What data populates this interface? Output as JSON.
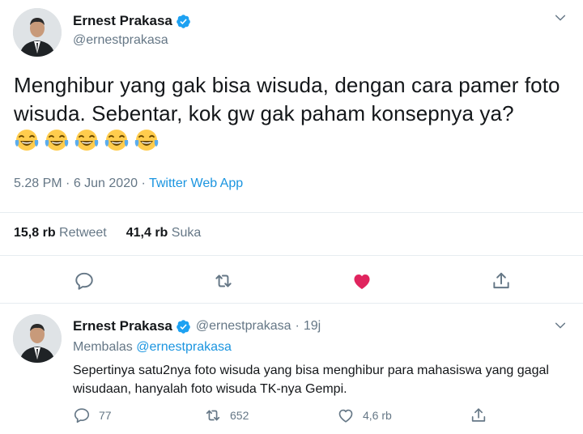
{
  "main_tweet": {
    "author_name": "Ernest Prakasa",
    "handle": "@ernestprakasa",
    "text": "Menghibur yang gak bisa wisuda, dengan cara pamer foto wisuda. Sebentar, kok gw gak paham konsepnya ya? ",
    "emojis": [
      "face-with-tears-of-joy",
      "face-with-tears-of-joy",
      "face-with-tears-of-joy",
      "face-with-tears-of-joy",
      "face-with-tears-of-joy"
    ],
    "time": "5.28 PM",
    "separator": " · ",
    "date": "6 Jun 2020",
    "app": "Twitter Web App",
    "retweets_count": "15,8 rb",
    "retweets_label": " Retweet",
    "likes_count": "41,4 rb",
    "likes_label": " Suka",
    "liked": true
  },
  "reply_tweet": {
    "author_name": "Ernest Prakasa",
    "handle": "@ernestprakasa",
    "age": "19j",
    "replying_label": "Membalas ",
    "replying_to": "@ernestprakasa",
    "text": "Sepertinya satu2nya foto wisuda yang bisa menghibur para mahasiswa yang gagal wisudaan, hanyalah foto wisuda TK-nya Gempi.",
    "reply_count": "77",
    "retweet_count": "652",
    "like_count": "4,6 rb"
  },
  "colors": {
    "accent": "#1b95e0",
    "secondary_text": "#657786",
    "like_active": "#e0245e",
    "divider": "#e6ecf0"
  }
}
